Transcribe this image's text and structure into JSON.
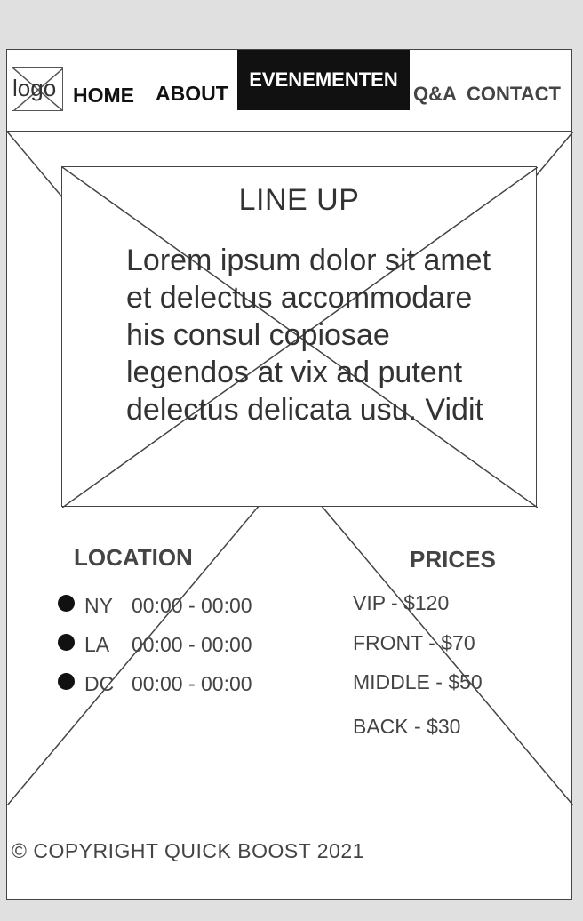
{
  "header": {
    "logo_label": "logo",
    "nav": {
      "home": "HOME",
      "about": "ABOUT",
      "evenementen": "EVENEMENTEN",
      "qa": "Q&A",
      "contact": "CONTACT"
    },
    "active_item": "EVENEMENTEN"
  },
  "hero": {
    "image_placeholder_icon": "image-placeholder-icon"
  },
  "lineup": {
    "title": "LINE UP",
    "text": "Lorem ipsum dolor sit amet et delectus accommodare his consul copiosae legendos at vix ad putent delectus delicata usu. Vidit"
  },
  "location": {
    "heading": "LOCATION",
    "items": [
      {
        "city": "NY",
        "time": "00:00 - 00:00"
      },
      {
        "city": "LA",
        "time": "00:00 - 00:00"
      },
      {
        "city": "DC",
        "time": "00:00 - 00:00"
      }
    ]
  },
  "prices": {
    "heading": "PRICES",
    "items": [
      {
        "label": "VIP - $120"
      },
      {
        "label": "FRONT - $70"
      },
      {
        "label": "MIDDLE - $50"
      },
      {
        "label": "BACK - $30"
      }
    ]
  },
  "footer": {
    "copyright": "© COPYRIGHT QUICK BOOST 2021"
  },
  "colors": {
    "page_bg": "#e0e0e0",
    "frame_bg": "#ffffff",
    "line": "#444444",
    "active_nav_bg": "#111111",
    "active_nav_text": "#ffffff"
  }
}
